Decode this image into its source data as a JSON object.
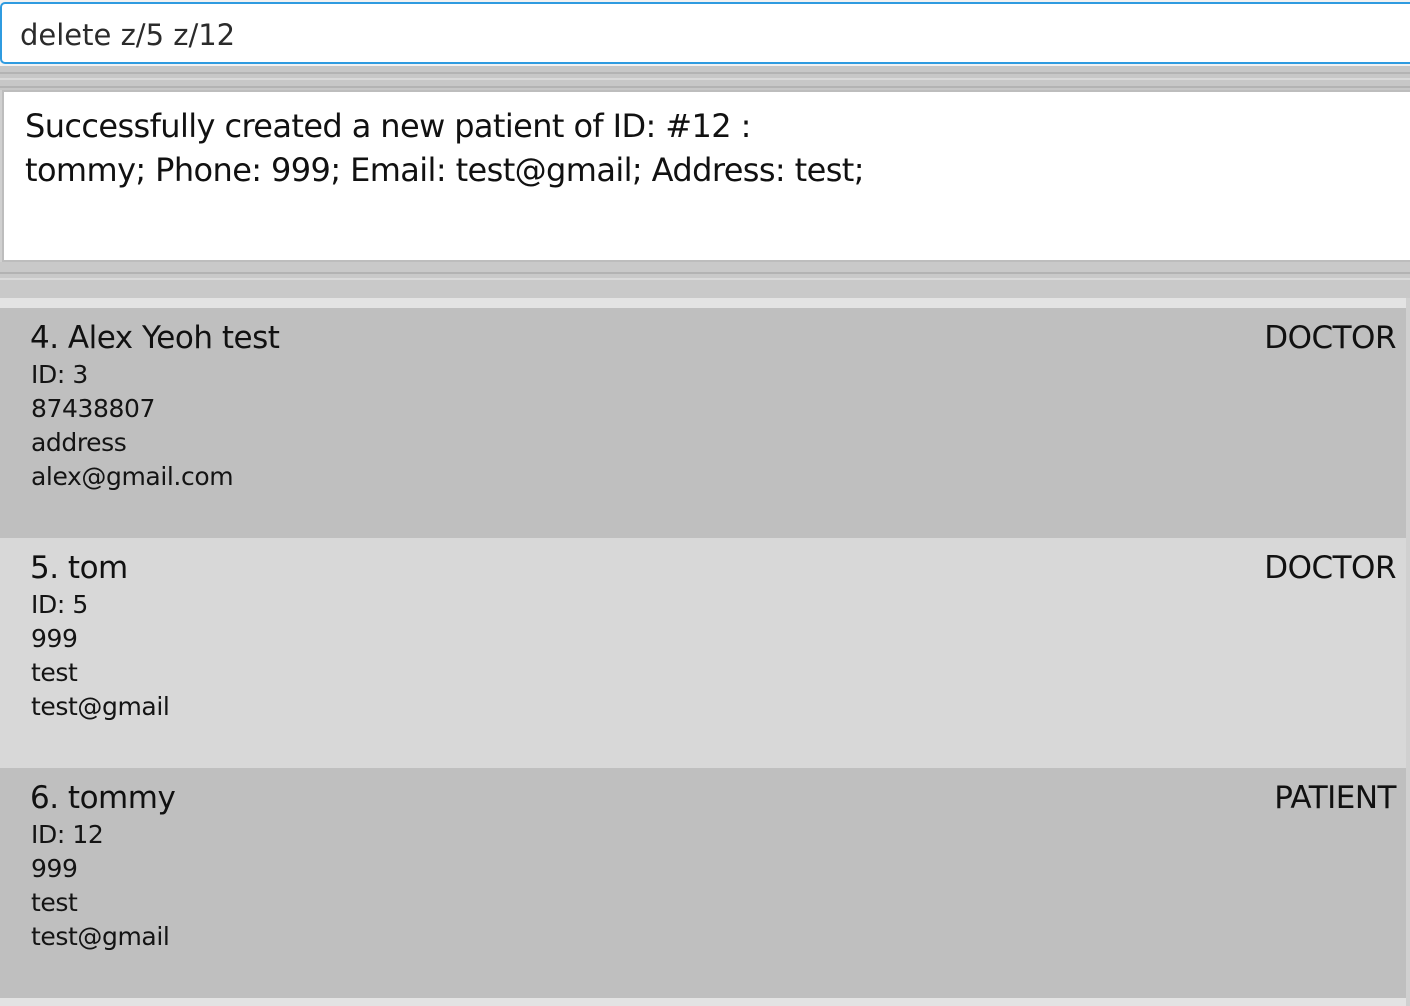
{
  "command_box": {
    "value": "delete z/5 z/12"
  },
  "result_display": {
    "text": "Successfully created a new patient of ID: #12 :\ntommy; Phone: 999; Email: test@gmail; Address: test;"
  },
  "person_list": [
    {
      "name": "4. Alex Yeoh test",
      "role": "DOCTOR",
      "id": "ID: 3",
      "phone": "87438807",
      "address": "address",
      "email": "alex@gmail.com"
    },
    {
      "name": "5. tom",
      "role": "DOCTOR",
      "id": "ID: 5",
      "phone": "999",
      "address": "test",
      "email": "test@gmail"
    },
    {
      "name": "6. tommy",
      "role": "PATIENT",
      "id": "ID: 12",
      "phone": "999",
      "address": "test",
      "email": "test@gmail"
    }
  ],
  "colors": {
    "input_border": "#2f9be0",
    "card_dark": "#bfbfbf",
    "card_light": "#d8d8d8"
  }
}
